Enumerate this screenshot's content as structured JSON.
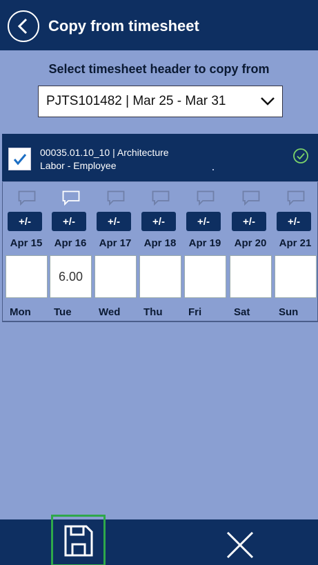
{
  "header": {
    "title": "Copy from timesheet"
  },
  "picker": {
    "prompt": "Select timesheet header to copy from",
    "selected": "PJTS101482 | Mar 25 - Mar 31"
  },
  "line": {
    "checked": true,
    "project": "00035.01.10_10 | Architecture",
    "category": "Labor - Employee",
    "status_icon": "check-circle-icon"
  },
  "adjust_label": "+/-",
  "days": [
    {
      "date": "Apr 15",
      "dow": "Mon",
      "hours": ""
    },
    {
      "date": "Apr 16",
      "dow": "Tue",
      "hours": "6.00"
    },
    {
      "date": "Apr 17",
      "dow": "Wed",
      "hours": ""
    },
    {
      "date": "Apr 18",
      "dow": "Thu",
      "hours": ""
    },
    {
      "date": "Apr 19",
      "dow": "Fri",
      "hours": ""
    },
    {
      "date": "Apr 20",
      "dow": "Sat",
      "hours": ""
    },
    {
      "date": "Apr 21",
      "dow": "Sun",
      "hours": ""
    }
  ],
  "colors": {
    "navy": "#0e2f61",
    "background": "#8a9fd2",
    "save_highlight": "#2ea84a"
  },
  "footer": {
    "save_icon": "save-icon",
    "cancel_icon": "close-icon"
  }
}
